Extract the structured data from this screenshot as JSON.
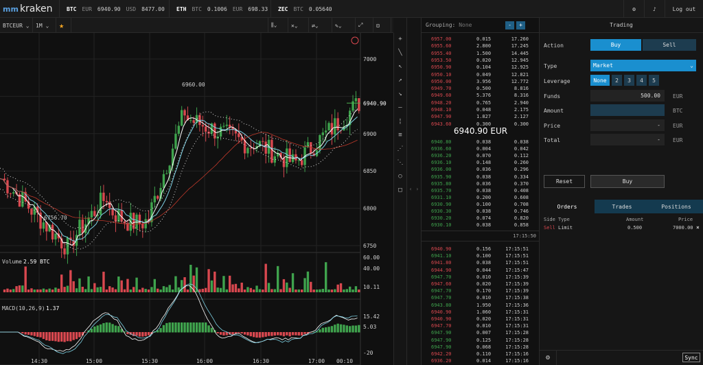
{
  "brand": {
    "name": "kraken"
  },
  "tickers": [
    {
      "sym": "BTC",
      "c1": "EUR",
      "v1": "6940.90",
      "c2": "USD",
      "v2": "8477.00"
    },
    {
      "sym": "ETH",
      "c1": "BTC",
      "v1": "0.1006",
      "c2": "EUR",
      "v2": "698.33"
    },
    {
      "sym": "ZEC",
      "c1": "BTC",
      "v1": "0.05640",
      "c2": "",
      "v2": ""
    }
  ],
  "top": {
    "logout": "Log out",
    "settings_icon": "gear-icon",
    "notify_icon": "bell-icon"
  },
  "chart": {
    "pair": "BTCEUR",
    "interval": "1M",
    "star_icon": "star-icon",
    "price_labels": [
      "7000",
      "6940.90",
      "6900",
      "6850",
      "6800",
      "6750"
    ],
    "high_label": "6960.00",
    "low_label": "6756.70",
    "volume_label": "Volume",
    "volume_value": "2.59 BTC",
    "volume_ticks": [
      "60.00",
      "40.00",
      "10.11"
    ],
    "macd_label": "MACD(10,26,9)",
    "macd_value": "1.37",
    "macd_ticks": [
      "15.42",
      "5.03",
      "-20"
    ],
    "times": [
      "14:30",
      "15:00",
      "15:30",
      "16:00",
      "16:30",
      "17:00",
      "00:10"
    ],
    "colors": {
      "up": "#3fa34d",
      "down": "#d9484f",
      "current": "#4caf50"
    }
  },
  "orderbook": {
    "grouping_label": "Grouping:",
    "grouping_value": "None",
    "minus": "-",
    "plus": "+",
    "asks": [
      [
        "6957.00",
        "0.015",
        "17.260"
      ],
      [
        "6955.60",
        "2.800",
        "17.245"
      ],
      [
        "6955.40",
        "1.500",
        "14.445"
      ],
      [
        "6953.50",
        "0.020",
        "12.945"
      ],
      [
        "6950.90",
        "0.104",
        "12.925"
      ],
      [
        "6950.10",
        "0.049",
        "12.821"
      ],
      [
        "6950.00",
        "3.956",
        "12.772"
      ],
      [
        "6949.70",
        "0.500",
        "8.816"
      ],
      [
        "6949.60",
        "5.376",
        "8.316"
      ],
      [
        "6948.20",
        "0.765",
        "2.940"
      ],
      [
        "6948.10",
        "0.048",
        "2.175"
      ],
      [
        "6947.90",
        "1.827",
        "2.127"
      ],
      [
        "6943.60",
        "0.300",
        "0.300"
      ]
    ],
    "last": "6940.90 EUR",
    "bids": [
      [
        "6940.80",
        "0.038",
        "0.038"
      ],
      [
        "6936.60",
        "0.004",
        "0.042"
      ],
      [
        "6936.20",
        "0.070",
        "0.112"
      ],
      [
        "6936.10",
        "0.148",
        "0.260"
      ],
      [
        "6936.00",
        "0.036",
        "0.296"
      ],
      [
        "6935.90",
        "0.038",
        "0.334"
      ],
      [
        "6935.80",
        "0.036",
        "0.370"
      ],
      [
        "6935.70",
        "0.038",
        "0.408"
      ],
      [
        "6931.10",
        "0.200",
        "0.608"
      ],
      [
        "6930.90",
        "0.100",
        "0.708"
      ],
      [
        "6930.30",
        "0.038",
        "0.746"
      ],
      [
        "6930.20",
        "0.074",
        "0.820"
      ],
      [
        "6930.10",
        "0.038",
        "0.858"
      ]
    ],
    "trades_time": "17:15:50",
    "trades": [
      [
        "r",
        "6940.90",
        "0.156",
        "17:15:51"
      ],
      [
        "g",
        "6941.10",
        "0.100",
        "17:15:51"
      ],
      [
        "r",
        "6941.80",
        "0.038",
        "17:15:51"
      ],
      [
        "r",
        "6944.90",
        "0.044",
        "17:15:47"
      ],
      [
        "g",
        "6947.70",
        "0.010",
        "17:15:39"
      ],
      [
        "r",
        "6947.60",
        "0.020",
        "17:15:39"
      ],
      [
        "g",
        "6947.70",
        "0.170",
        "17:15:39"
      ],
      [
        "g",
        "6947.70",
        "0.010",
        "17:15:38"
      ],
      [
        "g",
        "6943.80",
        "1.950",
        "17:15:36"
      ],
      [
        "r",
        "6940.90",
        "1.060",
        "17:15:31"
      ],
      [
        "r",
        "6940.90",
        "0.020",
        "17:15:31"
      ],
      [
        "r",
        "6947.70",
        "0.010",
        "17:15:31"
      ],
      [
        "g",
        "6947.90",
        "0.007",
        "17:15:28"
      ],
      [
        "g",
        "6947.90",
        "0.125",
        "17:15:28"
      ],
      [
        "g",
        "6947.90",
        "0.068",
        "17:15:28"
      ],
      [
        "r",
        "6942.20",
        "0.110",
        "17:15:16"
      ],
      [
        "r",
        "6936.20",
        "0.014",
        "17:15:16"
      ]
    ]
  },
  "trading": {
    "title": "Trading",
    "action": "Action",
    "buy": "Buy",
    "sell": "Sell",
    "type": "Type",
    "type_value": "Market",
    "leverage": "Leverage",
    "lev": [
      "None",
      "2",
      "3",
      "4",
      "5"
    ],
    "funds": "Funds",
    "funds_value": "500.00",
    "eur": "EUR",
    "amount": "Amount",
    "btc": "BTC",
    "price": "Price",
    "price_value": "-",
    "total": "Total",
    "total_value": "-",
    "reset": "Reset",
    "buy_btn": "Buy",
    "tabs": [
      "Orders",
      "Trades",
      "Positions"
    ],
    "cols": [
      "Side",
      "Type",
      "Amount",
      "Price"
    ],
    "order": {
      "side": "Sell",
      "type": "Limit",
      "amount": "0.500",
      "price": "7000.00",
      "close": "×"
    },
    "sync": "Sync"
  }
}
